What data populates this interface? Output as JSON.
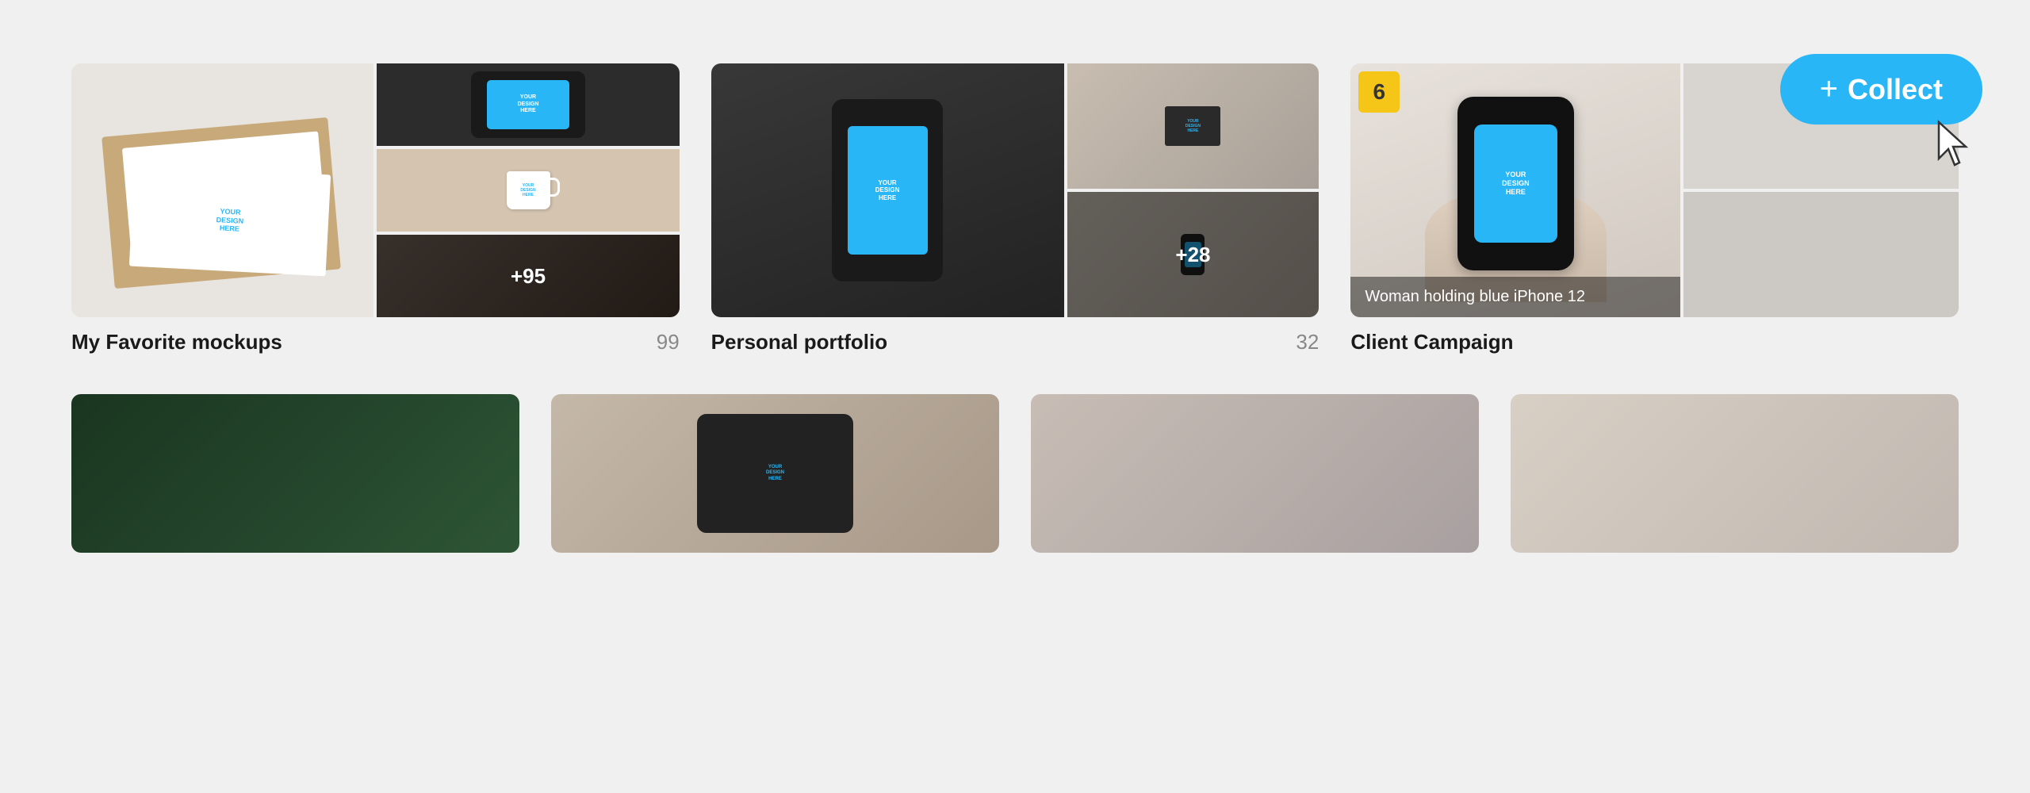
{
  "collect_button": {
    "label": "Collect",
    "plus": "+"
  },
  "collections": [
    {
      "name": "My Favorite mockups",
      "count": 99,
      "id": "favorites"
    },
    {
      "name": "Personal portfolio",
      "count": 32,
      "id": "portfolio"
    },
    {
      "name": "Client Campaign",
      "count": "",
      "id": "campaign",
      "badge_number": "6",
      "hover_label": "Woman holding blue iPhone 12"
    }
  ],
  "partial_collections": [
    {
      "id": "plants",
      "name": ""
    },
    {
      "id": "watch",
      "name": ""
    },
    {
      "id": "portrait",
      "name": ""
    },
    {
      "id": "fashion",
      "name": ""
    }
  ],
  "mockup_text": {
    "line1": "YOUR",
    "line2": "DESIGN",
    "line3": "HERE"
  },
  "overlay_labels": {
    "favorites_overlay": "+95",
    "portfolio_overlay": "+28"
  }
}
